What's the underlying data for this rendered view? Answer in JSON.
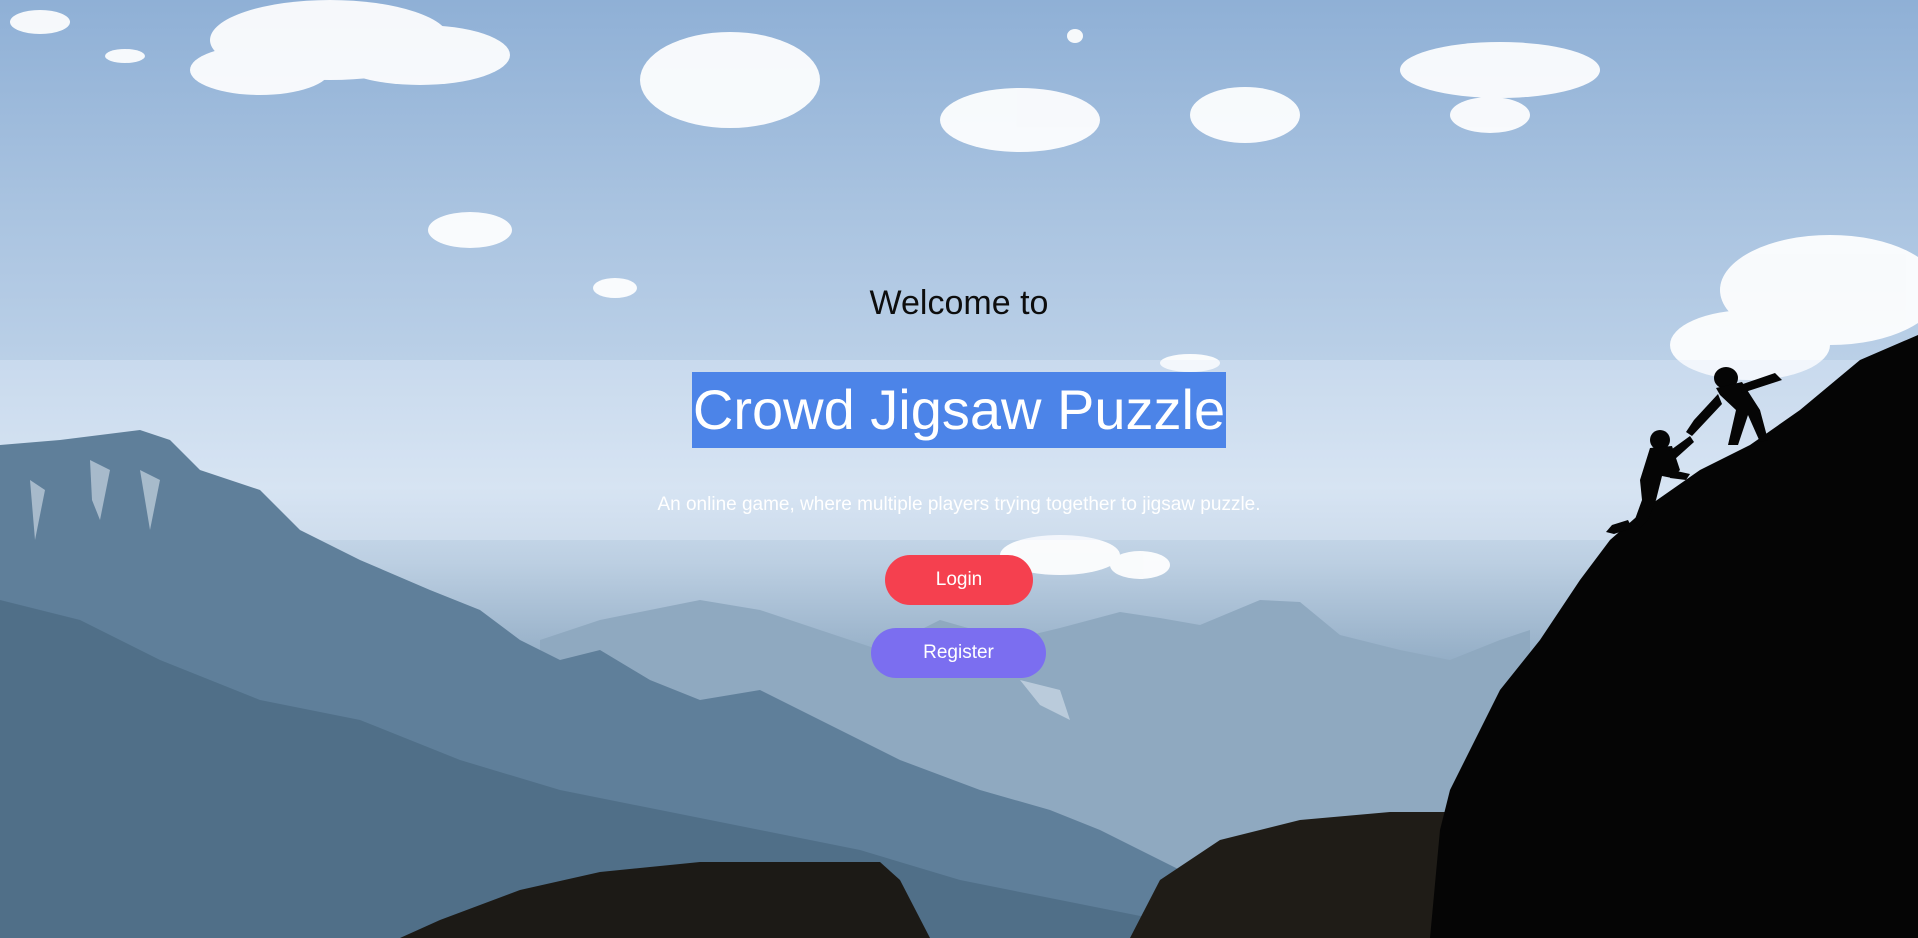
{
  "hero": {
    "welcome": "Welcome to",
    "title": "Crowd Jigsaw Puzzle",
    "tagline": "An online game, where multiple players trying together to jigsaw puzzle."
  },
  "actions": {
    "login_label": "Login",
    "register_label": "Register"
  },
  "colors": {
    "title_highlight": "#4c84e8",
    "login_button": "#f5404f",
    "register_button": "#7b6ef0"
  }
}
